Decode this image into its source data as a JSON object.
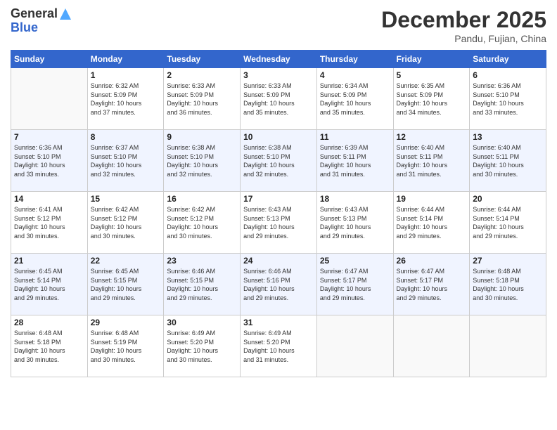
{
  "header": {
    "logo_general": "General",
    "logo_blue": "Blue",
    "month_title": "December 2025",
    "location": "Pandu, Fujian, China"
  },
  "days_of_week": [
    "Sunday",
    "Monday",
    "Tuesday",
    "Wednesday",
    "Thursday",
    "Friday",
    "Saturday"
  ],
  "weeks": [
    [
      {
        "day": "",
        "info": ""
      },
      {
        "day": "1",
        "info": "Sunrise: 6:32 AM\nSunset: 5:09 PM\nDaylight: 10 hours\nand 37 minutes."
      },
      {
        "day": "2",
        "info": "Sunrise: 6:33 AM\nSunset: 5:09 PM\nDaylight: 10 hours\nand 36 minutes."
      },
      {
        "day": "3",
        "info": "Sunrise: 6:33 AM\nSunset: 5:09 PM\nDaylight: 10 hours\nand 35 minutes."
      },
      {
        "day": "4",
        "info": "Sunrise: 6:34 AM\nSunset: 5:09 PM\nDaylight: 10 hours\nand 35 minutes."
      },
      {
        "day": "5",
        "info": "Sunrise: 6:35 AM\nSunset: 5:09 PM\nDaylight: 10 hours\nand 34 minutes."
      },
      {
        "day": "6",
        "info": "Sunrise: 6:36 AM\nSunset: 5:10 PM\nDaylight: 10 hours\nand 33 minutes."
      }
    ],
    [
      {
        "day": "7",
        "info": "Sunrise: 6:36 AM\nSunset: 5:10 PM\nDaylight: 10 hours\nand 33 minutes."
      },
      {
        "day": "8",
        "info": "Sunrise: 6:37 AM\nSunset: 5:10 PM\nDaylight: 10 hours\nand 32 minutes."
      },
      {
        "day": "9",
        "info": "Sunrise: 6:38 AM\nSunset: 5:10 PM\nDaylight: 10 hours\nand 32 minutes."
      },
      {
        "day": "10",
        "info": "Sunrise: 6:38 AM\nSunset: 5:10 PM\nDaylight: 10 hours\nand 32 minutes."
      },
      {
        "day": "11",
        "info": "Sunrise: 6:39 AM\nSunset: 5:11 PM\nDaylight: 10 hours\nand 31 minutes."
      },
      {
        "day": "12",
        "info": "Sunrise: 6:40 AM\nSunset: 5:11 PM\nDaylight: 10 hours\nand 31 minutes."
      },
      {
        "day": "13",
        "info": "Sunrise: 6:40 AM\nSunset: 5:11 PM\nDaylight: 10 hours\nand 30 minutes."
      }
    ],
    [
      {
        "day": "14",
        "info": "Sunrise: 6:41 AM\nSunset: 5:12 PM\nDaylight: 10 hours\nand 30 minutes."
      },
      {
        "day": "15",
        "info": "Sunrise: 6:42 AM\nSunset: 5:12 PM\nDaylight: 10 hours\nand 30 minutes."
      },
      {
        "day": "16",
        "info": "Sunrise: 6:42 AM\nSunset: 5:12 PM\nDaylight: 10 hours\nand 30 minutes."
      },
      {
        "day": "17",
        "info": "Sunrise: 6:43 AM\nSunset: 5:13 PM\nDaylight: 10 hours\nand 29 minutes."
      },
      {
        "day": "18",
        "info": "Sunrise: 6:43 AM\nSunset: 5:13 PM\nDaylight: 10 hours\nand 29 minutes."
      },
      {
        "day": "19",
        "info": "Sunrise: 6:44 AM\nSunset: 5:14 PM\nDaylight: 10 hours\nand 29 minutes."
      },
      {
        "day": "20",
        "info": "Sunrise: 6:44 AM\nSunset: 5:14 PM\nDaylight: 10 hours\nand 29 minutes."
      }
    ],
    [
      {
        "day": "21",
        "info": "Sunrise: 6:45 AM\nSunset: 5:14 PM\nDaylight: 10 hours\nand 29 minutes."
      },
      {
        "day": "22",
        "info": "Sunrise: 6:45 AM\nSunset: 5:15 PM\nDaylight: 10 hours\nand 29 minutes."
      },
      {
        "day": "23",
        "info": "Sunrise: 6:46 AM\nSunset: 5:15 PM\nDaylight: 10 hours\nand 29 minutes."
      },
      {
        "day": "24",
        "info": "Sunrise: 6:46 AM\nSunset: 5:16 PM\nDaylight: 10 hours\nand 29 minutes."
      },
      {
        "day": "25",
        "info": "Sunrise: 6:47 AM\nSunset: 5:17 PM\nDaylight: 10 hours\nand 29 minutes."
      },
      {
        "day": "26",
        "info": "Sunrise: 6:47 AM\nSunset: 5:17 PM\nDaylight: 10 hours\nand 29 minutes."
      },
      {
        "day": "27",
        "info": "Sunrise: 6:48 AM\nSunset: 5:18 PM\nDaylight: 10 hours\nand 30 minutes."
      }
    ],
    [
      {
        "day": "28",
        "info": "Sunrise: 6:48 AM\nSunset: 5:18 PM\nDaylight: 10 hours\nand 30 minutes."
      },
      {
        "day": "29",
        "info": "Sunrise: 6:48 AM\nSunset: 5:19 PM\nDaylight: 10 hours\nand 30 minutes."
      },
      {
        "day": "30",
        "info": "Sunrise: 6:49 AM\nSunset: 5:20 PM\nDaylight: 10 hours\nand 30 minutes."
      },
      {
        "day": "31",
        "info": "Sunrise: 6:49 AM\nSunset: 5:20 PM\nDaylight: 10 hours\nand 31 minutes."
      },
      {
        "day": "",
        "info": ""
      },
      {
        "day": "",
        "info": ""
      },
      {
        "day": "",
        "info": ""
      }
    ]
  ]
}
